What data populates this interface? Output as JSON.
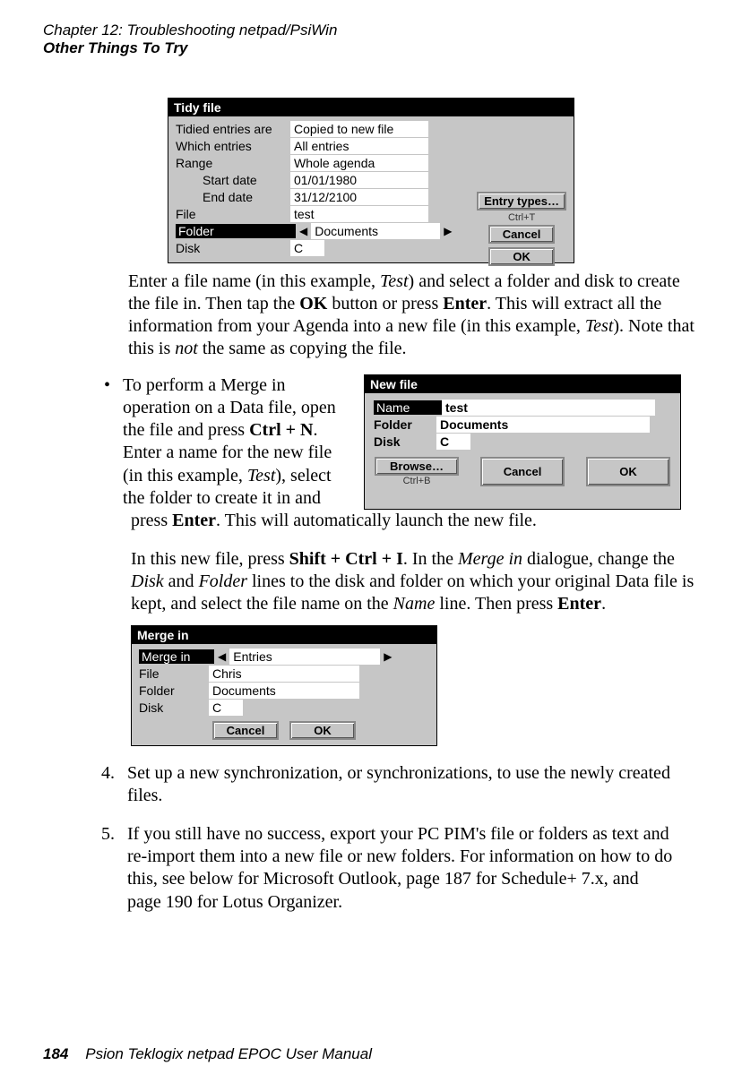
{
  "header": {
    "chapter": "Chapter 12:  Troubleshooting netpad/PsiWin",
    "section": "Other Things To Try"
  },
  "tidy": {
    "title": "Tidy file",
    "rows": [
      {
        "label": "Tidied entries are",
        "value": "Copied to new file"
      },
      {
        "label": "Which entries",
        "value": "All entries"
      },
      {
        "label": "Range",
        "value": "Whole agenda"
      },
      {
        "label": "Start date",
        "value": "01/01/1980"
      },
      {
        "label": "End date",
        "value": "31/12/2100"
      },
      {
        "label": "File",
        "value": "test"
      },
      {
        "label": "Folder",
        "value": "Documents"
      },
      {
        "label": "Disk",
        "value": "C"
      }
    ],
    "buttons": {
      "entry_types": "Entry types…",
      "entry_types_shortcut": "Ctrl+T",
      "cancel": "Cancel",
      "ok": "OK"
    }
  },
  "paragraphs": {
    "p1": {
      "a": "Enter a file name (in this example, ",
      "i1": "Test",
      "b": ") and select a folder and disk to create the file in. Then tap the ",
      "bold1": "OK",
      "c": " button or press ",
      "bold2": "Enter",
      "d": ". This will extract all the information from your Agenda into a new file (in this example, ",
      "i2": "Test",
      "e": "). Note that this is ",
      "i3": "not",
      "f": " the same as copying the file."
    },
    "bullet": {
      "a": "To perform a Merge in operation on a Data file, open the file and press ",
      "bold1": "Ctrl + N",
      "b": ". Enter a name for the new file (in this example, ",
      "i1": "Test",
      "c": "), select the folder to create it in and",
      "d": "press ",
      "bold2": "Enter",
      "e": ". This will automatically launch the new file."
    },
    "p2": {
      "a": "In this new file, press ",
      "bold1": "Shift + Ctrl + I",
      "b": ". In the ",
      "i1": "Merge in",
      "c": " dialogue, change the ",
      "i2": "Disk",
      "d": " and ",
      "i3": "Folder",
      "e": " lines to the disk and folder on which your original Data file is kept, and select the file name on the ",
      "i4": "Name",
      "f": " line. Then press ",
      "bold2": "Enter",
      "g": "."
    }
  },
  "newfile": {
    "title": "New file",
    "rows": [
      {
        "label": "Name",
        "value": "test"
      },
      {
        "label": "Folder",
        "value": "Documents"
      },
      {
        "label": "Disk",
        "value": "C"
      }
    ],
    "buttons": {
      "browse": "Browse…",
      "browse_shortcut": "Ctrl+B",
      "cancel": "Cancel",
      "ok": "OK"
    }
  },
  "merge": {
    "title": "Merge in",
    "rows": [
      {
        "label": "Merge in",
        "value": "Entries"
      },
      {
        "label": "File",
        "value": "Chris"
      },
      {
        "label": "Folder",
        "value": "Documents"
      },
      {
        "label": "Disk",
        "value": "C"
      }
    ],
    "buttons": {
      "cancel": "Cancel",
      "ok": "OK"
    }
  },
  "steps": [
    {
      "num": "4.",
      "text": "Set up a new synchronization, or synchronizations, to use the newly created files."
    },
    {
      "num": "5.",
      "text": "If you still have no success, export your PC PIM's file or folders as text and re-import them into a new file or new folders. For information on how to do this, see below for Microsoft Outlook, page 187 for Schedule+ 7.x, and page 190 for Lotus Organizer."
    }
  ],
  "footer": {
    "page": "184",
    "title": "Psion Teklogix netpad EPOC User Manual"
  }
}
